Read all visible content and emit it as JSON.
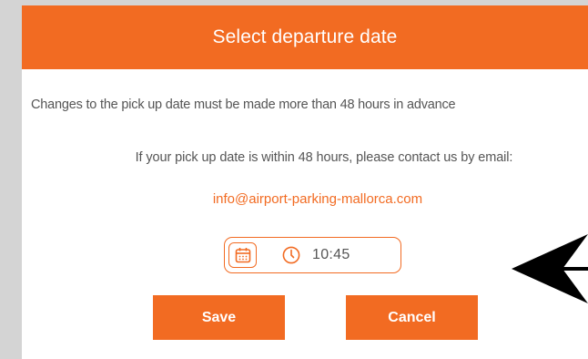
{
  "modal": {
    "title": "Select departure date",
    "notice_line": "Changes to the pick up date must be made more than 48 hours in advance",
    "contact_line": "If your pick up date is within 48 hours, please contact us by email:",
    "email": "info@airport-parking-mallorca.com"
  },
  "datetime": {
    "date_icon": "calendar-icon",
    "time_icon": "clock-icon",
    "time_value": "10:45"
  },
  "buttons": {
    "save_label": "Save",
    "cancel_label": "Cancel"
  },
  "colors": {
    "accent": "#f26b22",
    "background": "#d4d4d4",
    "text": "#555555"
  }
}
